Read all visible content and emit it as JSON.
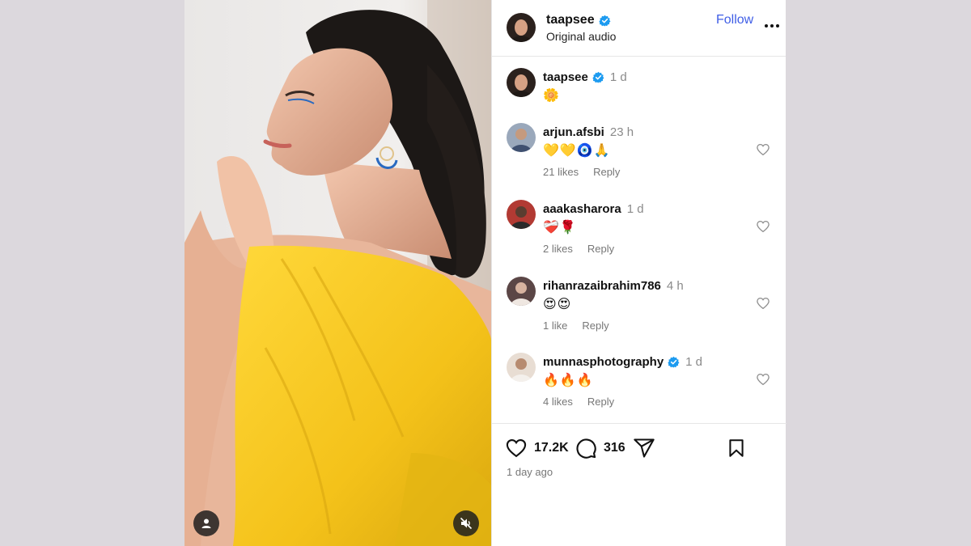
{
  "header": {
    "username": "taapsee",
    "subtitle": "Original audio",
    "follow_label": "Follow"
  },
  "caption": {
    "username": "taapsee",
    "time": "1 d",
    "text": "🌼"
  },
  "comments": [
    {
      "username": "arjun.afsbi",
      "time": "23 h",
      "text": "💛💛🧿🙏",
      "likes": "21 likes",
      "reply": "Reply",
      "verified": false,
      "avatar_color": "#7f8fa6"
    },
    {
      "username": "aaakasharora",
      "time": "1 d",
      "text": "❤️‍🩹🌹",
      "likes": "2 likes",
      "reply": "Reply",
      "verified": false,
      "avatar_color": "#a8322e"
    },
    {
      "username": "rihanrazaibrahim786",
      "time": "4 h",
      "text": "😍😍",
      "likes": "1 like",
      "reply": "Reply",
      "verified": false,
      "avatar_color": "#6f5a58"
    },
    {
      "username": "munnasphotography",
      "time": "1 d",
      "text": "🔥🔥🔥",
      "likes": "4 likes",
      "reply": "Reply",
      "verified": true,
      "avatar_color": "#caa98b"
    }
  ],
  "actions": {
    "likes_count": "17.2K",
    "comments_count": "316",
    "posted_ago": "1 day ago"
  },
  "icons": {
    "verified": "verified-badge-icon",
    "heart": "heart-icon",
    "comment": "comment-icon",
    "share": "share-icon",
    "save": "bookmark-icon",
    "more": "more-icon",
    "tag": "user-tag-icon",
    "mute": "muted-icon"
  },
  "colors": {
    "accent": "#3f5ee6",
    "verified": "#1d9bf0",
    "dress": "#f5c81c"
  }
}
